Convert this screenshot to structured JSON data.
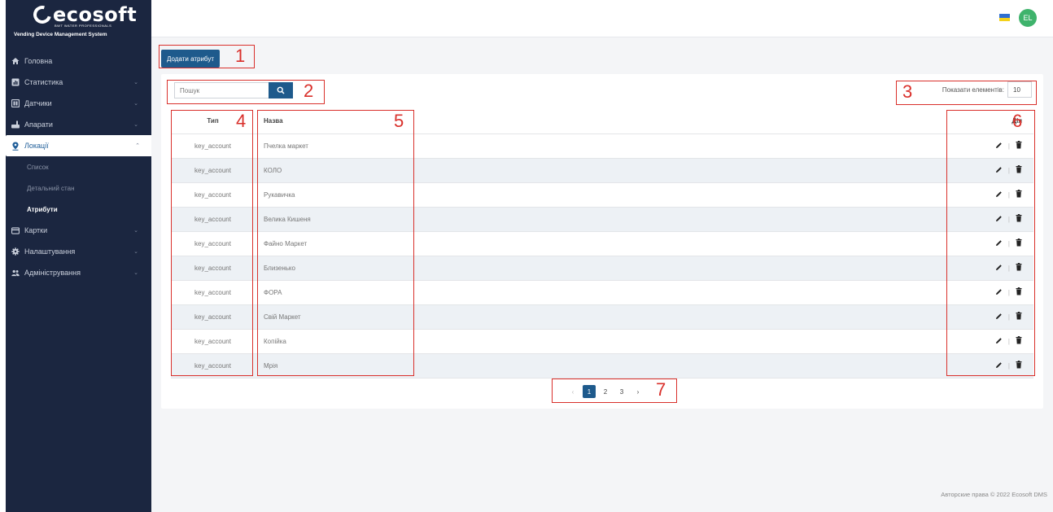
{
  "brand": {
    "name": "ecosoft",
    "tagline": "BWT WATER PROFESSIONALS",
    "system": "Vending Device Management System"
  },
  "sidebar": {
    "items": [
      {
        "label": "Головна",
        "icon": "home-icon"
      },
      {
        "label": "Статистика",
        "icon": "stats-icon"
      },
      {
        "label": "Датчики",
        "icon": "sensor-icon"
      },
      {
        "label": "Апарати",
        "icon": "machine-icon"
      },
      {
        "label": "Локації",
        "icon": "location-pin-icon"
      },
      {
        "label": "Картки",
        "icon": "card-icon"
      },
      {
        "label": "Налаштування",
        "icon": "gear-icon"
      },
      {
        "label": "Адміністрування",
        "icon": "users-icon"
      }
    ],
    "locations_submenu": [
      "Список",
      "Детальний стан",
      "Атрибути"
    ]
  },
  "header": {
    "user_initials": "EL"
  },
  "main": {
    "add_button": "Додати атрибут",
    "search_placeholder": "Пошук",
    "page_size_label": "Показати елементів:",
    "page_size_value": "10",
    "columns": [
      "Тип",
      "Назва",
      "Дія"
    ],
    "rows": [
      {
        "type": "key_account",
        "name": "Пчелка маркет"
      },
      {
        "type": "key_account",
        "name": "КОЛО"
      },
      {
        "type": "key_account",
        "name": "Рукавичка"
      },
      {
        "type": "key_account",
        "name": "Велика Кишеня"
      },
      {
        "type": "key_account",
        "name": "Файно Маркет"
      },
      {
        "type": "key_account",
        "name": "Близенько"
      },
      {
        "type": "key_account",
        "name": "ФОРА"
      },
      {
        "type": "key_account",
        "name": "Свій Маркет"
      },
      {
        "type": "key_account",
        "name": "Копійка"
      },
      {
        "type": "key_account",
        "name": "Мрія"
      }
    ],
    "pagination": {
      "prev": "‹",
      "pages": [
        "1",
        "2",
        "3"
      ],
      "next": "›",
      "current": "1"
    }
  },
  "footer": {
    "copyright": "Авторские права © 2022 Ecosoft DMS"
  },
  "annotations": [
    "1",
    "2",
    "3",
    "4",
    "5",
    "6",
    "7"
  ],
  "colors": {
    "sidebar_bg": "#1b2640",
    "primary": "#1e5a8c",
    "annotation": "#d9302b",
    "avatar": "#3fb36c"
  }
}
